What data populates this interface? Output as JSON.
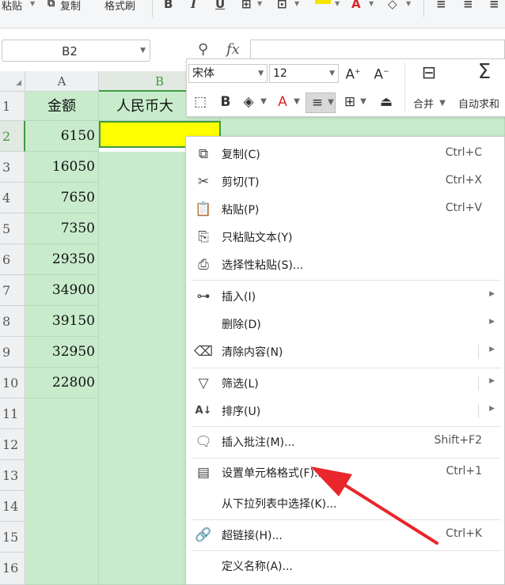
{
  "ribbon": {
    "paste_label": "粘贴",
    "copy_label": "复制",
    "format_painter_label": "格式刷",
    "bold_icon": "bold-icon",
    "italic_icon": "italic-icon",
    "underline_icon": "underline-icon"
  },
  "formula_bar": {
    "name_box": "B2",
    "fx_label": "fx",
    "zoom_icon": "zoom-icon"
  },
  "sheet": {
    "columns": [
      "A",
      "B"
    ],
    "rows": [
      "1",
      "2",
      "3",
      "4",
      "5",
      "6",
      "7",
      "8",
      "9",
      "10",
      "11",
      "12",
      "13",
      "14",
      "15",
      "16"
    ],
    "a1": "金额",
    "b1": "人民币大",
    "amounts": [
      "6150",
      "16050",
      "7650",
      "7350",
      "29350",
      "34900",
      "39150",
      "32950",
      "22800"
    ],
    "active_cell_color": "#ffff00",
    "selection_color": "#c8eccb",
    "accent_color": "#3f9a3f"
  },
  "mini_toolbar": {
    "font_name": "宋体",
    "font_size": "12",
    "merge_label": "合并",
    "autosum_label": "自动求和"
  },
  "context_menu": {
    "items": [
      {
        "icon": "copy-icon",
        "label": "复制(C)",
        "shortcut": "Ctrl+C"
      },
      {
        "icon": "cut-icon",
        "label": "剪切(T)",
        "shortcut": "Ctrl+X"
      },
      {
        "icon": "paste-icon",
        "label": "粘贴(P)",
        "shortcut": "Ctrl+V"
      },
      {
        "icon": "paste-text-icon",
        "label": "只粘贴文本(Y)",
        "shortcut": ""
      },
      {
        "icon": "paste-special-icon",
        "label": "选择性粘贴(S)...",
        "shortcut": ""
      },
      {
        "icon": "insert-icon",
        "label": "插入(I)",
        "shortcut": ""
      },
      {
        "icon": "",
        "label": "删除(D)",
        "shortcut": ""
      },
      {
        "icon": "clear-icon",
        "label": "清除内容(N)",
        "shortcut": ""
      },
      {
        "icon": "filter-icon",
        "label": "筛选(L)",
        "shortcut": ""
      },
      {
        "icon": "sort-icon",
        "label": "排序(U)",
        "shortcut": ""
      },
      {
        "icon": "comment-icon",
        "label": "插入批注(M)...",
        "shortcut": "Shift+F2"
      },
      {
        "icon": "format-cells-icon",
        "label": "设置单元格格式(F)...",
        "shortcut": "Ctrl+1"
      },
      {
        "icon": "",
        "label": "从下拉列表中选择(K)...",
        "shortcut": ""
      },
      {
        "icon": "hyperlink-icon",
        "label": "超链接(H)...",
        "shortcut": "Ctrl+K"
      },
      {
        "icon": "",
        "label": "定义名称(A)...",
        "shortcut": ""
      }
    ],
    "arrow_color": "#e8262b"
  }
}
